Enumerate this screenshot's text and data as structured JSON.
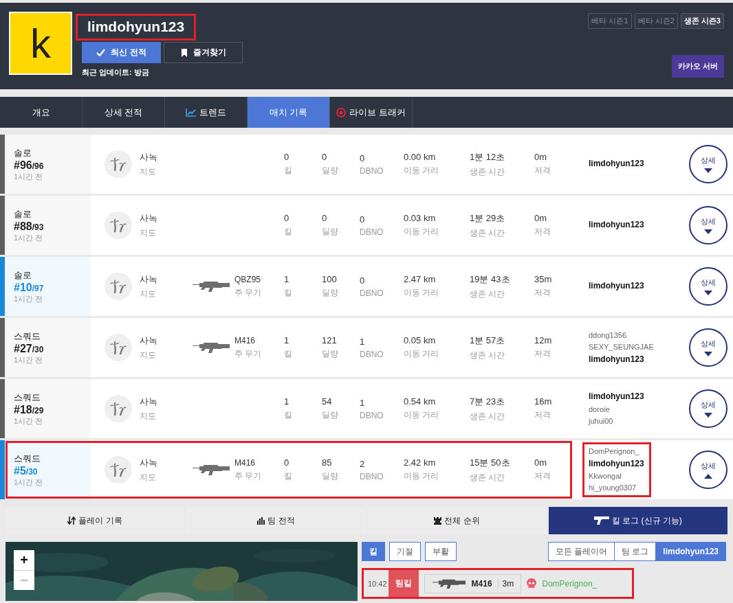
{
  "header": {
    "avatar_letter": "k",
    "username": "limdohyun123",
    "username_highlighted": true,
    "buttons": [
      {
        "label": "최신 전적",
        "kind": "primary"
      },
      {
        "label": "즐겨찾기",
        "kind": "bookmark"
      }
    ],
    "updated": "최근 업데이트: 방금",
    "seasons": [
      {
        "label": "베타 시즌1",
        "selected": false
      },
      {
        "label": "베타 시즌2",
        "selected": false
      },
      {
        "label": "생존 시즌3",
        "selected": true
      }
    ],
    "server_button": "카카오 서버"
  },
  "nav_tabs": [
    {
      "label": "개요",
      "kind": "plain",
      "selected": false
    },
    {
      "label": "상세 전적",
      "kind": "plain",
      "selected": false
    },
    {
      "label": "트렌드",
      "kind": "trend",
      "selected": false
    },
    {
      "label": "매치 기록",
      "kind": "plain",
      "selected": true
    },
    {
      "label": "라이브 트래커",
      "kind": "live",
      "selected": false
    }
  ],
  "matches": [
    {
      "mode": "솔로",
      "rank": "#96",
      "total": "/96",
      "time": "1시간 전",
      "top_rank": false,
      "highlighted": false,
      "map": "사녹",
      "map_label": "지도",
      "stats": [
        {
          "value": "0",
          "label": "킬"
        },
        {
          "value": "0",
          "label": "딜량"
        },
        {
          "value": "0",
          "label": "DBNO"
        },
        {
          "value": "0.00 km",
          "label": "이동 거리"
        },
        {
          "value": "1분 12초",
          "label": "생존 시간"
        },
        {
          "value": "0m",
          "label": "저격"
        }
      ],
      "players": [
        {
          "name": "limdohyun123",
          "self": true
        }
      ],
      "players_highlighted": false,
      "detail": {
        "label": "상세",
        "expanded": false
      }
    },
    {
      "mode": "솔로",
      "rank": "#88",
      "total": "/93",
      "time": "1시간 전",
      "top_rank": false,
      "highlighted": false,
      "map": "사녹",
      "map_label": "지도",
      "stats": [
        {
          "value": "0",
          "label": "킬"
        },
        {
          "value": "0",
          "label": "딜량"
        },
        {
          "value": "0",
          "label": "DBNO"
        },
        {
          "value": "0.03 km",
          "label": "이동 거리"
        },
        {
          "value": "1분 29초",
          "label": "생존 시간"
        },
        {
          "value": "0m",
          "label": "저격"
        }
      ],
      "players": [
        {
          "name": "limdohyun123",
          "self": true
        }
      ],
      "players_highlighted": false,
      "detail": {
        "label": "상세",
        "expanded": false
      }
    },
    {
      "mode": "솔로",
      "rank": "#10",
      "total": "/97",
      "time": "1시간 전",
      "top_rank": true,
      "highlighted": false,
      "map": "사녹",
      "map_label": "지도",
      "weapon": {
        "name": "QBZ95",
        "label": "주 무기"
      },
      "stats": [
        {
          "value": "1",
          "label": "킬"
        },
        {
          "value": "100",
          "label": "딜량"
        },
        {
          "value": "0",
          "label": "DBNO"
        },
        {
          "value": "2.47 km",
          "label": "이동 거리"
        },
        {
          "value": "19분 43초",
          "label": "생존 시간"
        },
        {
          "value": "35m",
          "label": "저격"
        }
      ],
      "players": [
        {
          "name": "limdohyun123",
          "self": true
        }
      ],
      "players_highlighted": false,
      "detail": {
        "label": "상세",
        "expanded": false
      }
    },
    {
      "mode": "스쿼드",
      "rank": "#27",
      "total": "/30",
      "time": "1시간 전",
      "top_rank": false,
      "highlighted": false,
      "map": "사녹",
      "map_label": "지도",
      "weapon": {
        "name": "M416",
        "label": "주 무기"
      },
      "stats": [
        {
          "value": "1",
          "label": "킬"
        },
        {
          "value": "121",
          "label": "딜량"
        },
        {
          "value": "1",
          "label": "DBNO"
        },
        {
          "value": "0.05 km",
          "label": "이동 거리"
        },
        {
          "value": "1분 57초",
          "label": "생존 시간"
        },
        {
          "value": "12m",
          "label": "저격"
        }
      ],
      "players": [
        {
          "name": "ddong1356",
          "self": false
        },
        {
          "name": "SEXY_SEUNGJAE",
          "self": false
        },
        {
          "name": "limdohyun123",
          "self": true
        }
      ],
      "players_highlighted": false,
      "detail": {
        "label": "상세",
        "expanded": false
      }
    },
    {
      "mode": "스쿼드",
      "rank": "#18",
      "total": "/29",
      "time": "1시간 전",
      "top_rank": false,
      "highlighted": false,
      "map": "사녹",
      "map_label": "지도",
      "stats": [
        {
          "value": "1",
          "label": "킬"
        },
        {
          "value": "54",
          "label": "딜량"
        },
        {
          "value": "1",
          "label": "DBNO"
        },
        {
          "value": "0.54 km",
          "label": "이동 거리"
        },
        {
          "value": "7분 23초",
          "label": "생존 시간"
        },
        {
          "value": "16m",
          "label": "저격"
        }
      ],
      "players": [
        {
          "name": "limdohyun123",
          "self": true
        },
        {
          "name": "doroie",
          "self": false
        },
        {
          "name": "juhui00",
          "self": false
        }
      ],
      "players_highlighted": false,
      "detail": {
        "label": "상세",
        "expanded": false
      }
    },
    {
      "mode": "스쿼드",
      "rank": "#5",
      "total": "/30",
      "time": "1시간 전",
      "top_rank": true,
      "highlighted": true,
      "map": "사녹",
      "map_label": "지도",
      "weapon": {
        "name": "M416",
        "label": "주 무기"
      },
      "stats": [
        {
          "value": "0",
          "label": "킬"
        },
        {
          "value": "85",
          "label": "딜량"
        },
        {
          "value": "2",
          "label": "DBNO"
        },
        {
          "value": "2.42 km",
          "label": "이동 거리"
        },
        {
          "value": "15분 50초",
          "label": "생존 시간"
        },
        {
          "value": "0m",
          "label": "저격"
        }
      ],
      "players": [
        {
          "name": "DomPerignon_",
          "self": false
        },
        {
          "name": "limdohyun123",
          "self": true
        },
        {
          "name": "Kkwongal",
          "self": false
        },
        {
          "name": "hi_young0307",
          "self": false
        }
      ],
      "players_highlighted": true,
      "detail": {
        "label": "상세",
        "expanded": true
      }
    }
  ],
  "sub_tabs": [
    {
      "label": "플레이 기록",
      "kind": "sort",
      "selected": false
    },
    {
      "label": "팀 전적",
      "kind": "bars",
      "selected": false
    },
    {
      "label": "전체 순위",
      "kind": "crown",
      "selected": false
    },
    {
      "label": "킬 로그 (신규 기능)",
      "kind": "gun",
      "selected": true
    }
  ],
  "kill_log": {
    "map": {
      "zoom_in": "+",
      "zoom_out": "−",
      "zoom_out_disabled": true
    },
    "filters": [
      {
        "label": "킬",
        "selected": true
      },
      {
        "label": "기절",
        "selected": false
      },
      {
        "label": "부활",
        "selected": false
      }
    ],
    "views": [
      {
        "label": "모든 플레이어",
        "selected": false
      },
      {
        "label": "팀 로그",
        "selected": false
      },
      {
        "label": "limdohyun123",
        "selected": true
      }
    ],
    "entries": [
      {
        "time": "10:42",
        "type": "팀킬",
        "kind": "teamkill",
        "weapon": "M416",
        "distance": "3m",
        "victim": "DomPerignon_",
        "highlighted": true
      }
    ]
  }
}
